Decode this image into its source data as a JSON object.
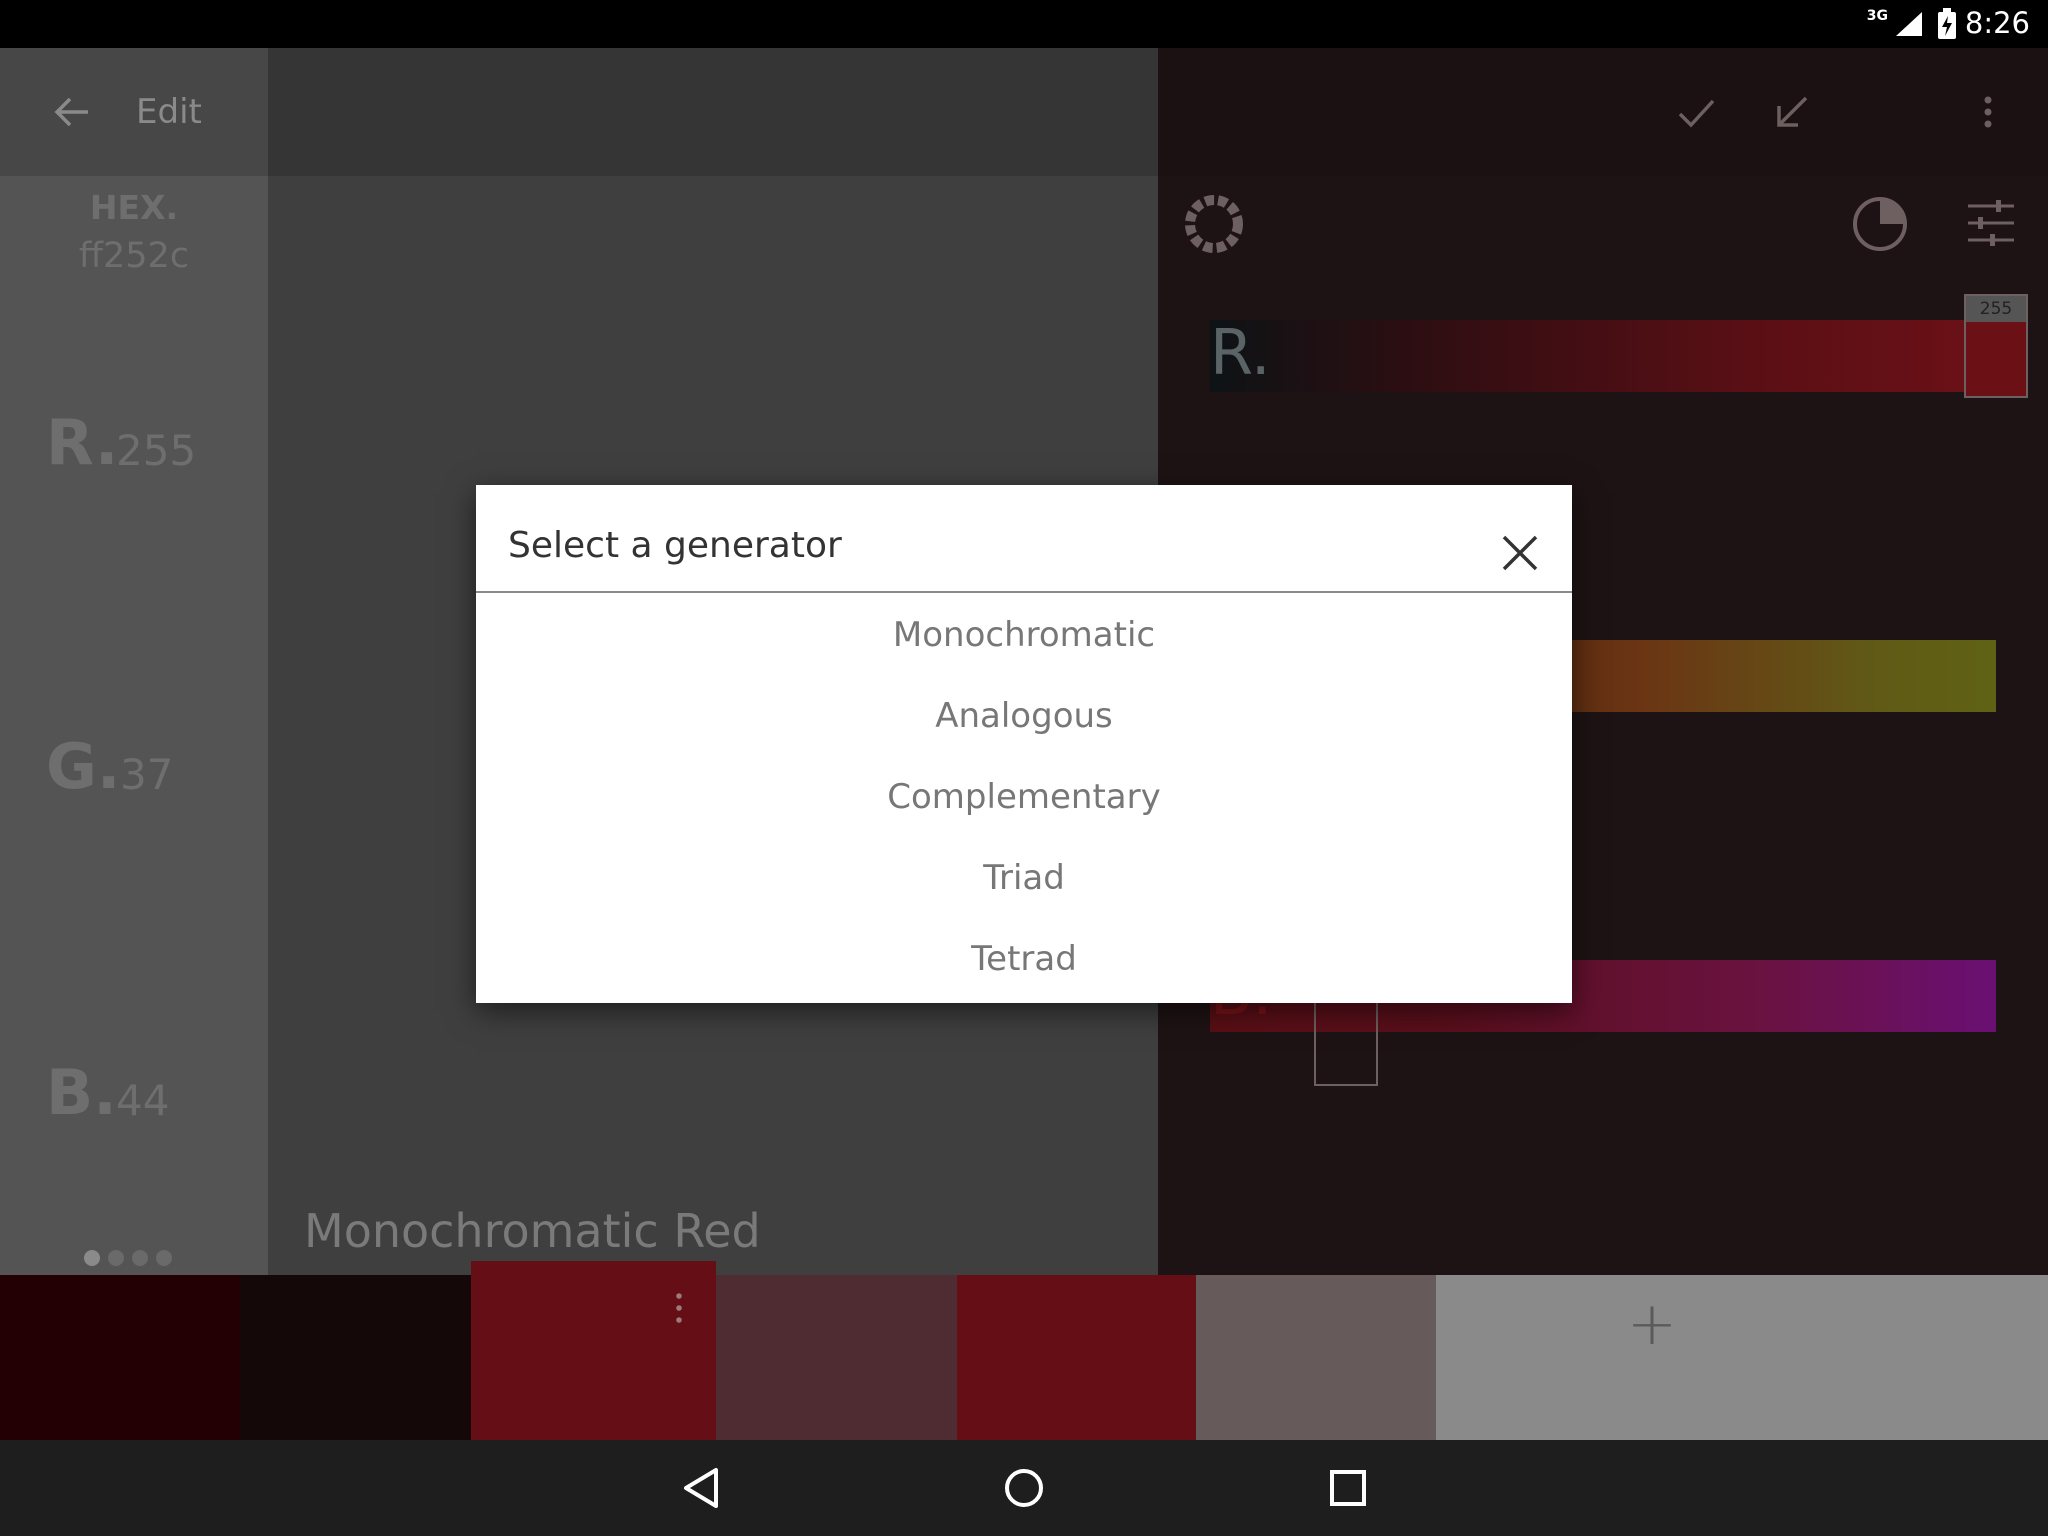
{
  "status_bar": {
    "time": "8:26",
    "network": "3G"
  },
  "toolbar": {
    "title": "Edit"
  },
  "color_info": {
    "hex_label": "HEX.",
    "hex_value": "ff252c",
    "r_label": "R.",
    "r_value": "255",
    "g_label": "G.",
    "g_value": "37",
    "b_label": "B.",
    "b_value": "44"
  },
  "palette_name": "Monochromatic Red",
  "sliders": {
    "r_label": "R.",
    "r_value": "255",
    "b_label": "B."
  },
  "palette": {
    "swatches": [
      "#220004",
      "#150809",
      "#660e15",
      "#4e2c31",
      "#660e15",
      "#665a5a"
    ],
    "add_label": "+"
  },
  "dialog": {
    "title": "Select a generator",
    "options": [
      "Monochromatic",
      "Analogous",
      "Complementary",
      "Triad",
      "Tetrad"
    ]
  }
}
